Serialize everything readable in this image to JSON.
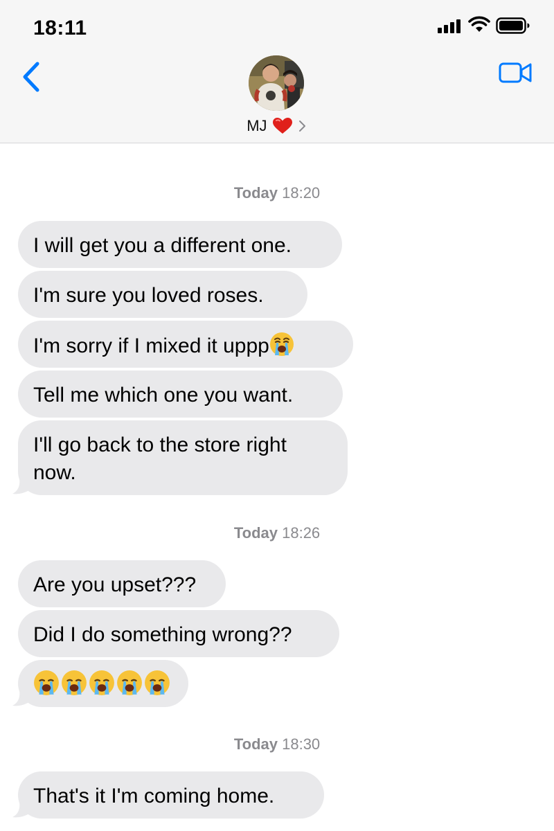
{
  "status_bar": {
    "time": "18:11"
  },
  "header": {
    "contact_name": "MJ",
    "heart_icon": "red-heart-icon",
    "back_icon": "chevron-left-icon",
    "video_icon": "video-camera-icon",
    "accent_color": "#007aff"
  },
  "conversation": {
    "groups": [
      {
        "timestamp_day": "Today",
        "timestamp_time": "18:20",
        "messages": [
          "I will get you a different one.",
          "I'm sure you loved roses.",
          "I'm sorry if I mixed it uppp",
          "Tell me which one you want.",
          "I'll go back to the store right now."
        ]
      },
      {
        "timestamp_day": "Today",
        "timestamp_time": "18:26",
        "messages": [
          "Are you upset???",
          "Did I do something wrong??",
          ""
        ]
      },
      {
        "timestamp_day": "Today",
        "timestamp_time": "18:30",
        "messages": [
          "That's it I'm coming home."
        ]
      }
    ]
  },
  "colors": {
    "incoming_bubble": "#e9e9eb",
    "timestamp_text": "#8a8a8e",
    "header_bg": "#f6f6f6"
  }
}
